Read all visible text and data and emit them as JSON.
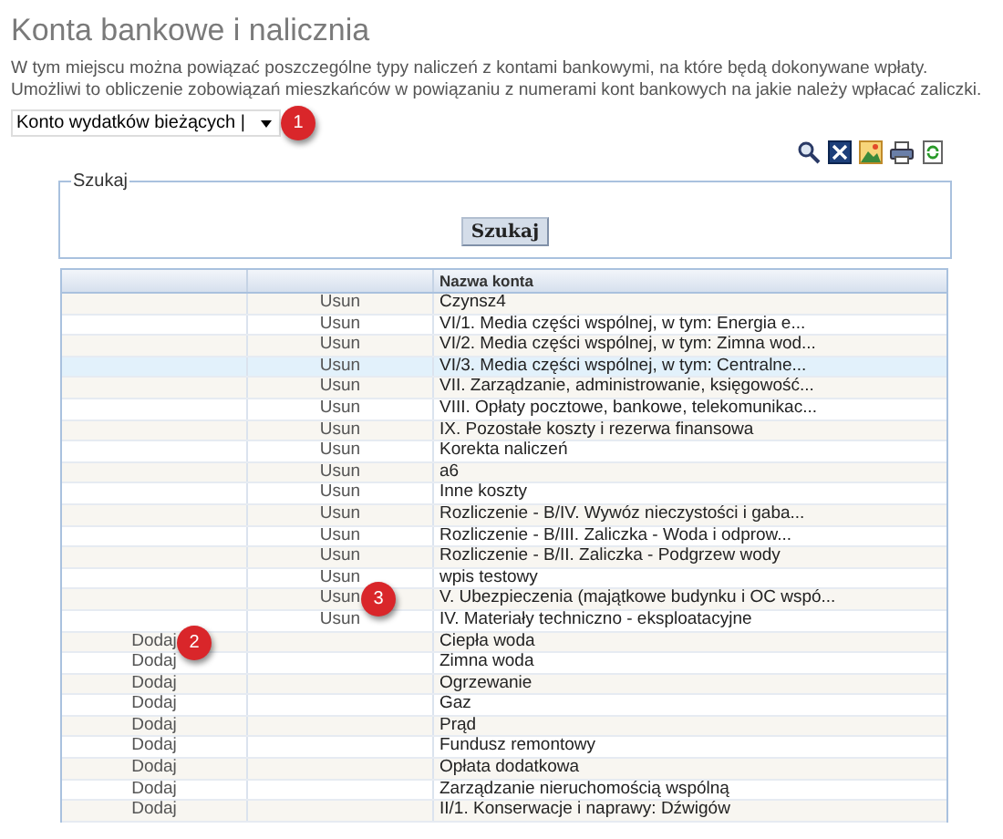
{
  "title": "Konta bankowe i nalicznia",
  "description": "W tym miejscu można powiązać poszczególne typy naliczeń z kontami bankowymi, na które będą dokonywane wpłaty. Umożliwi to obliczenie zobowiązań mieszkańców w powiązaniu z numerami kont bankowych na jakie należy wpłacać zaliczki.",
  "account_select": {
    "value": "Konto wydatków bieżących |",
    "marker": "1"
  },
  "search": {
    "legend": "Szukaj",
    "button": "Szukaj"
  },
  "table": {
    "columns": [
      "",
      "",
      "Nazwa konta"
    ],
    "rows": [
      {
        "kind": "remove",
        "action": "Usun",
        "name": "Czynsz4",
        "selected": false
      },
      {
        "kind": "remove",
        "action": "Usun",
        "name": "VI/1. Media części wspólnej, w tym: Energia e...",
        "selected": false
      },
      {
        "kind": "remove",
        "action": "Usun",
        "name": "VI/2. Media części wspólnej, w tym: Zimna wod...",
        "selected": false
      },
      {
        "kind": "remove",
        "action": "Usun",
        "name": "VI/3. Media części wspólnej, w tym: Centralne...",
        "selected": true
      },
      {
        "kind": "remove",
        "action": "Usun",
        "name": "VII. Zarządzanie, administrowanie, księgowość...",
        "selected": false
      },
      {
        "kind": "remove",
        "action": "Usun",
        "name": "VIII. Opłaty pocztowe, bankowe, telekomunikac...",
        "selected": false
      },
      {
        "kind": "remove",
        "action": "Usun",
        "name": "IX. Pozostałe koszty i rezerwa finansowa",
        "selected": false
      },
      {
        "kind": "remove",
        "action": "Usun",
        "name": "Korekta naliczeń",
        "selected": false
      },
      {
        "kind": "remove",
        "action": "Usun",
        "name": "a6",
        "selected": false
      },
      {
        "kind": "remove",
        "action": "Usun",
        "name": "Inne koszty",
        "selected": false
      },
      {
        "kind": "remove",
        "action": "Usun",
        "name": "Rozliczenie - B/IV. Wywóz nieczystości i gaba...",
        "selected": false
      },
      {
        "kind": "remove",
        "action": "Usun",
        "name": "Rozliczenie - B/III. Zaliczka - Woda i odprow...",
        "selected": false
      },
      {
        "kind": "remove",
        "action": "Usun",
        "name": "Rozliczenie - B/II. Zaliczka - Podgrzew wody",
        "selected": false
      },
      {
        "kind": "remove",
        "action": "Usun",
        "name": "wpis testowy",
        "selected": false
      },
      {
        "kind": "remove",
        "action": "Usun",
        "name": "V. Ubezpieczenia (majątkowe budynku i OC wspó...",
        "selected": false,
        "marker": "3"
      },
      {
        "kind": "remove",
        "action": "Usun",
        "name": "IV. Materiały techniczno - eksploatacyjne",
        "selected": false
      },
      {
        "kind": "add",
        "action": "Dodaj",
        "name": "Ciepła woda",
        "selected": false,
        "marker": "2"
      },
      {
        "kind": "add",
        "action": "Dodaj",
        "name": "Zimna woda",
        "selected": false
      },
      {
        "kind": "add",
        "action": "Dodaj",
        "name": "Ogrzewanie",
        "selected": false
      },
      {
        "kind": "add",
        "action": "Dodaj",
        "name": "Gaz",
        "selected": false
      },
      {
        "kind": "add",
        "action": "Dodaj",
        "name": "Prąd",
        "selected": false
      },
      {
        "kind": "add",
        "action": "Dodaj",
        "name": "Fundusz remontowy",
        "selected": false
      },
      {
        "kind": "add",
        "action": "Dodaj",
        "name": "Opłata dodatkowa",
        "selected": false
      },
      {
        "kind": "add",
        "action": "Dodaj",
        "name": "Zarządzanie nieruchomością wspólną",
        "selected": false
      },
      {
        "kind": "add",
        "action": "Dodaj",
        "name": "II/1. Konserwacje i naprawy: Dźwigów",
        "selected": false
      }
    ]
  }
}
